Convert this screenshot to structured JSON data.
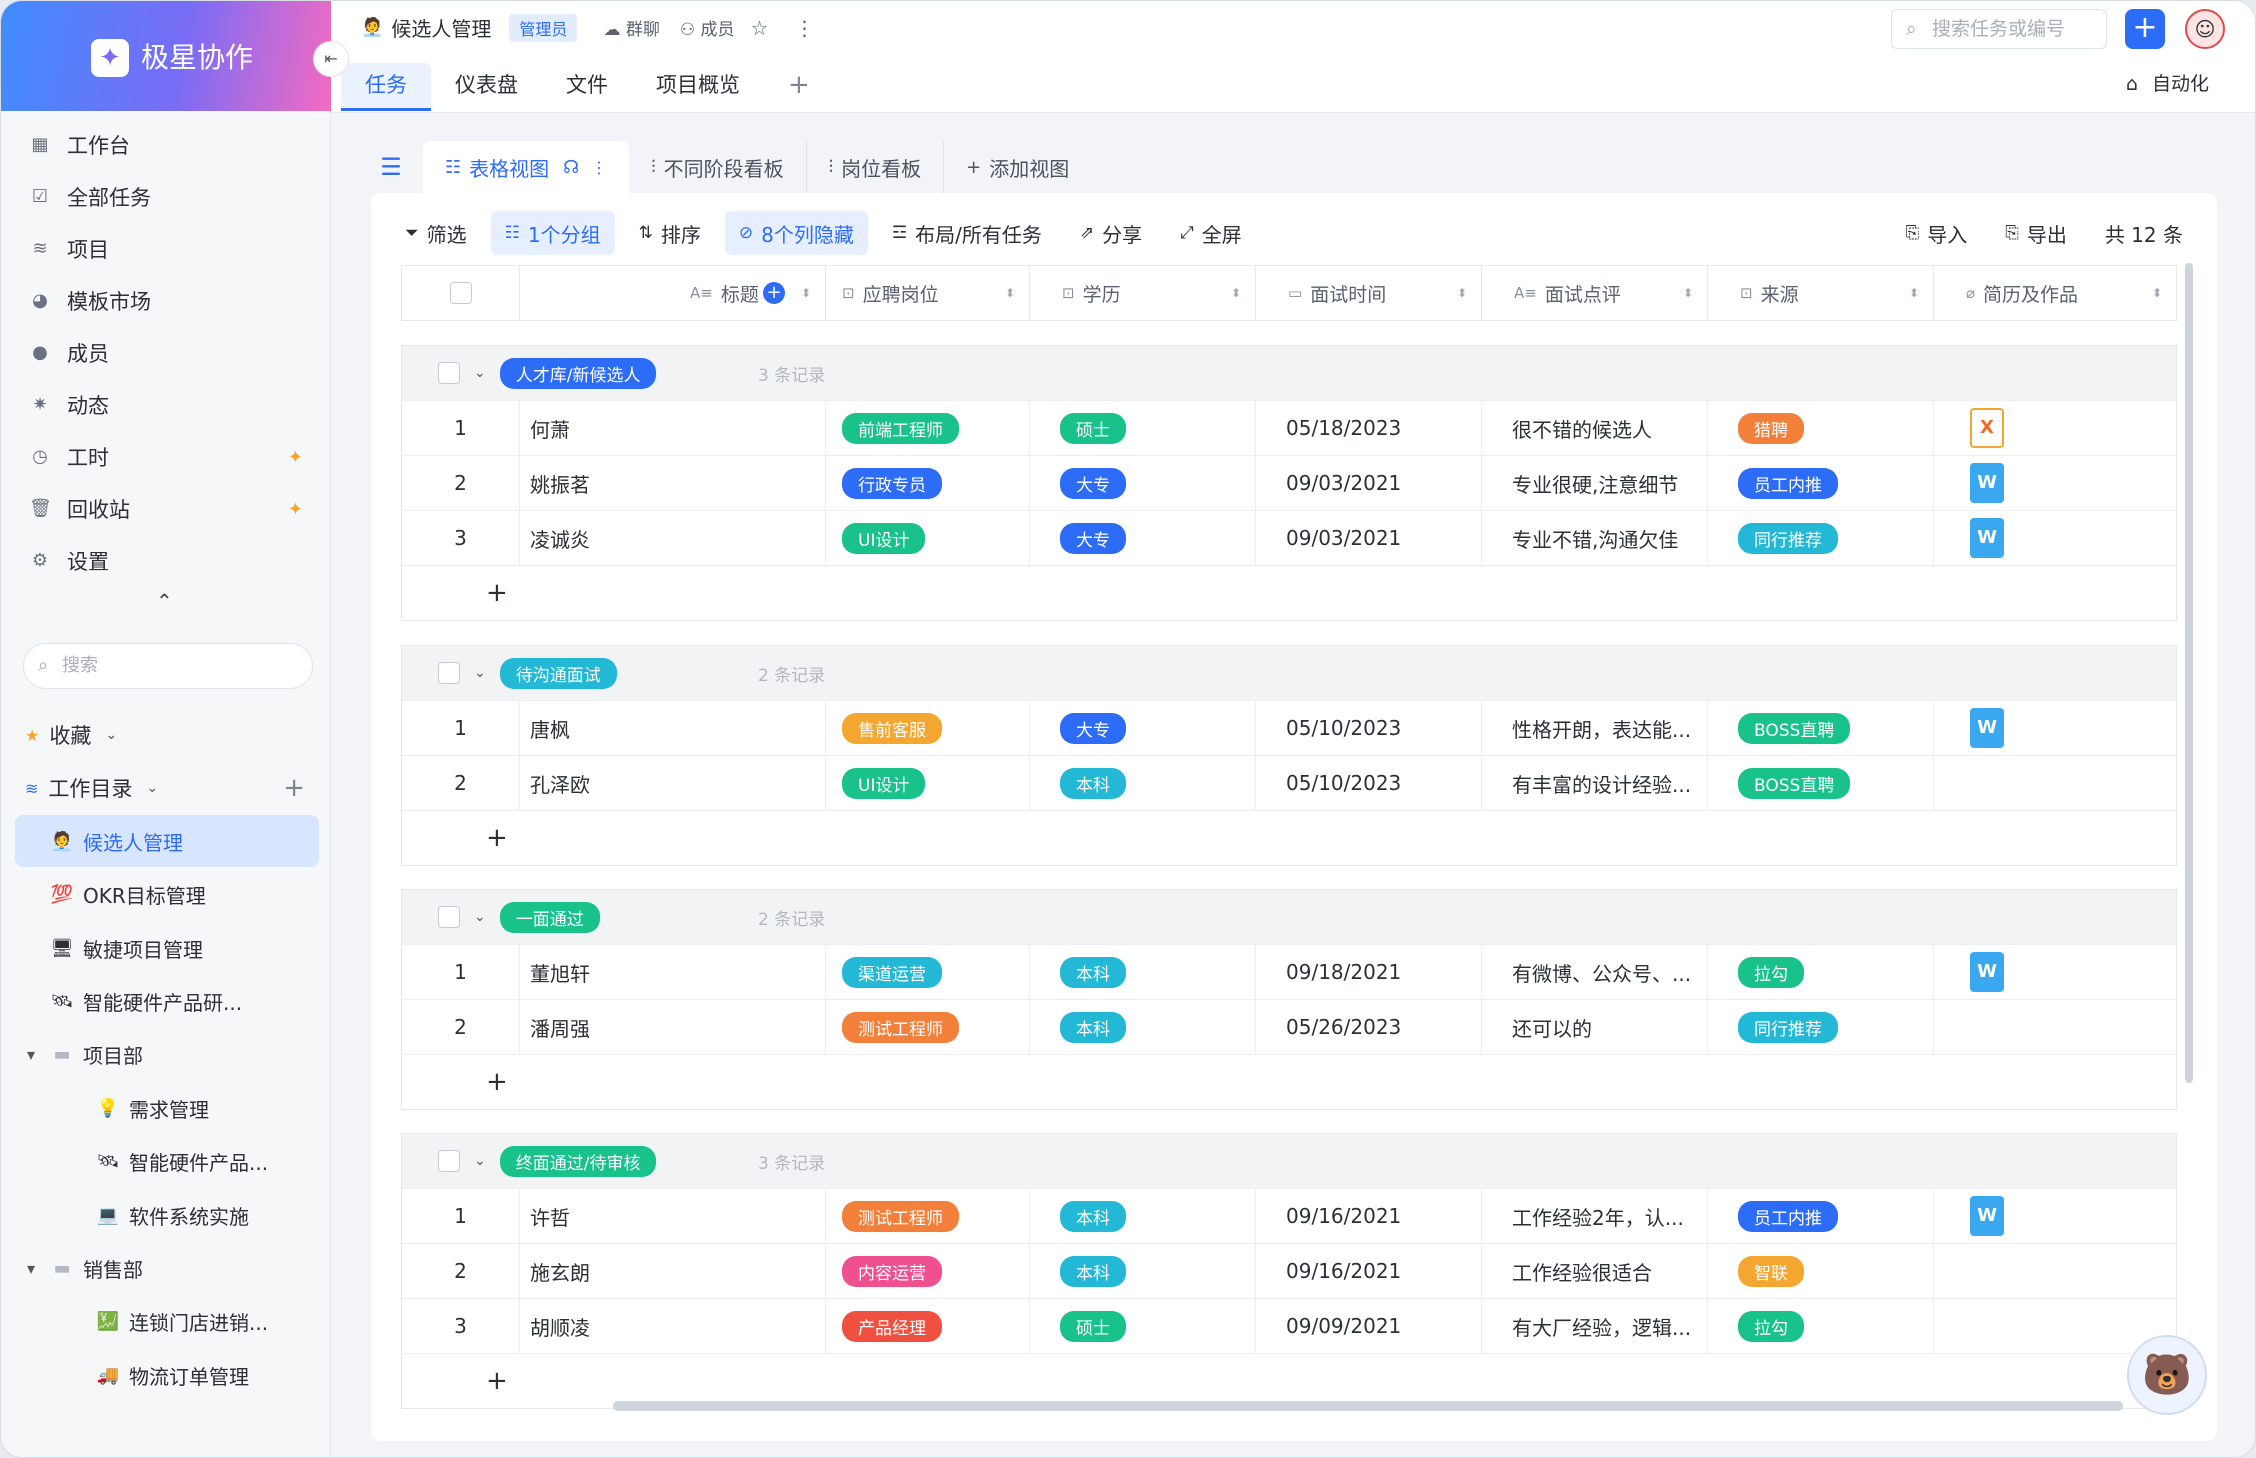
{
  "brand": {
    "logo": "✦",
    "name": "极星协作"
  },
  "sidebar": {
    "collapse_label": "⇤",
    "nav": [
      {
        "label": "工作台",
        "icon": "▦"
      },
      {
        "label": "全部任务",
        "icon": "☑"
      },
      {
        "label": "项目",
        "icon": "≋"
      },
      {
        "label": "模板市场",
        "icon": "◕"
      },
      {
        "label": "成员",
        "icon": "●"
      },
      {
        "label": "动态",
        "icon": "✷"
      },
      {
        "label": "工时",
        "icon": "◷",
        "star": "✦"
      },
      {
        "label": "回收站",
        "icon": "🗑",
        "star": "✦"
      },
      {
        "label": "设置",
        "icon": "⚙"
      }
    ],
    "search_placeholder": "搜索",
    "favorites_label": "收藏",
    "workdir_label": "工作目录",
    "tree": [
      {
        "label": "候选人管理",
        "emoji": "🧑‍💼"
      },
      {
        "label": "OKR目标管理",
        "emoji": "💯"
      },
      {
        "label": "敏捷项目管理",
        "emoji": "🖥"
      },
      {
        "label": "智能硬件产品研...",
        "emoji": "🛰"
      },
      {
        "label": "项目部",
        "emoji": "▬"
      },
      {
        "label": "需求管理",
        "emoji": "💡"
      },
      {
        "label": "智能硬件产品...",
        "emoji": "🛰"
      },
      {
        "label": "软件系统实施",
        "emoji": "💻"
      },
      {
        "label": "销售部",
        "emoji": "▬"
      },
      {
        "label": "连锁门店进销...",
        "emoji": "💹"
      },
      {
        "label": "物流订单管理",
        "emoji": "🚚"
      }
    ]
  },
  "header": {
    "project_emoji": "🧑‍💼",
    "project_title": "候选人管理",
    "role": "管理员",
    "group_chat": "群聊",
    "members": "成员",
    "search_placeholder": "搜索任务或编号",
    "add_label": "+",
    "tabs": [
      "任务",
      "仪表盘",
      "文件",
      "项目概览",
      "+"
    ],
    "automate": "自动化"
  },
  "views": {
    "tabs": [
      "表格视图",
      "不同阶段看板",
      "岗位看板",
      "添加视图"
    ]
  },
  "toolbar": {
    "filter": "筛选",
    "group": "1个分组",
    "sort": "排序",
    "hidden": "8个列隐藏",
    "layout": "布局/所有任务",
    "share": "分享",
    "fullscreen": "全屏",
    "import": "导入",
    "export": "导出",
    "total": "共 12 条"
  },
  "columns": [
    "标题",
    "应聘岗位",
    "学历",
    "面试时间",
    "面试点评",
    "来源",
    "简历及作品"
  ],
  "colors": {
    "accent": "#2d6cf6",
    "green": "#19c28a",
    "orange": "#f2803a",
    "blue": "#2d6cf6",
    "teal": "#22b8d6",
    "pink": "#f0508f",
    "red": "#f0503f",
    "gold": "#f4a630"
  },
  "groups": [
    {
      "name": "人才库/新候选人",
      "color": "#2d6cf6",
      "count": "3 条记录",
      "rows": [
        {
          "no": "1",
          "title": "何萧",
          "job": {
            "text": "前端工程师",
            "color": "#19c28a"
          },
          "edu": {
            "text": "硕士",
            "color": "#19c28a"
          },
          "time": "05/18/2023",
          "review": "很不错的候选人",
          "source": {
            "text": "猎聘",
            "color": "#f2803a"
          },
          "file": "X"
        },
        {
          "no": "2",
          "title": "姚振茗",
          "job": {
            "text": "行政专员",
            "color": "#2d6cf6"
          },
          "edu": {
            "text": "大专",
            "color": "#2d6cf6"
          },
          "time": "09/03/2021",
          "review": "专业很硬,注意细节",
          "source": {
            "text": "员工内推",
            "color": "#2d6cf6"
          },
          "file": "W"
        },
        {
          "no": "3",
          "title": "凌诚炎",
          "job": {
            "text": "UI设计",
            "color": "#19c28a"
          },
          "edu": {
            "text": "大专",
            "color": "#2d6cf6"
          },
          "time": "09/03/2021",
          "review": "专业不错,沟通欠佳",
          "source": {
            "text": "同行推荐",
            "color": "#22b8d6"
          },
          "file": "W"
        }
      ]
    },
    {
      "name": "待沟通面试",
      "color": "#22b8d6",
      "count": "2 条记录",
      "rows": [
        {
          "no": "1",
          "title": "唐枫",
          "job": {
            "text": "售前客服",
            "color": "#f4a630"
          },
          "edu": {
            "text": "大专",
            "color": "#2d6cf6"
          },
          "time": "05/10/2023",
          "review": "性格开朗，表达能...",
          "source": {
            "text": "BOSS直聘",
            "color": "#19c28a"
          },
          "file": "W"
        },
        {
          "no": "2",
          "title": "孔泽欧",
          "job": {
            "text": "UI设计",
            "color": "#19c28a"
          },
          "edu": {
            "text": "本科",
            "color": "#22b8d6"
          },
          "time": "05/10/2023",
          "review": "有丰富的设计经验...",
          "source": {
            "text": "BOSS直聘",
            "color": "#19c28a"
          },
          "file": ""
        }
      ]
    },
    {
      "name": "一面通过",
      "color": "#19c28a",
      "count": "2 条记录",
      "rows": [
        {
          "no": "1",
          "title": "董旭轩",
          "job": {
            "text": "渠道运营",
            "color": "#22b8d6"
          },
          "edu": {
            "text": "本科",
            "color": "#22b8d6"
          },
          "time": "09/18/2021",
          "review": "有微博、公众号、...",
          "source": {
            "text": "拉勾",
            "color": "#19c28a"
          },
          "file": "W"
        },
        {
          "no": "2",
          "title": "潘周强",
          "job": {
            "text": "测试工程师",
            "color": "#f2803a"
          },
          "edu": {
            "text": "本科",
            "color": "#22b8d6"
          },
          "time": "05/26/2023",
          "review": "还可以的",
          "source": {
            "text": "同行推荐",
            "color": "#22b8d6"
          },
          "file": ""
        }
      ]
    },
    {
      "name": "终面通过/待审核",
      "color": "#19c28a",
      "count": "3 条记录",
      "rows": [
        {
          "no": "1",
          "title": "许哲",
          "job": {
            "text": "测试工程师",
            "color": "#f2803a"
          },
          "edu": {
            "text": "本科",
            "color": "#22b8d6"
          },
          "time": "09/16/2021",
          "review": "工作经验2年，认...",
          "source": {
            "text": "员工内推",
            "color": "#2d6cf6"
          },
          "file": "W"
        },
        {
          "no": "2",
          "title": "施玄朗",
          "job": {
            "text": "内容运营",
            "color": "#f0508f"
          },
          "edu": {
            "text": "本科",
            "color": "#22b8d6"
          },
          "time": "09/16/2021",
          "review": "工作经验很适合",
          "source": {
            "text": "智联",
            "color": "#f4a630"
          },
          "file": ""
        },
        {
          "no": "3",
          "title": "胡顺凌",
          "job": {
            "text": "产品经理",
            "color": "#f0503f"
          },
          "edu": {
            "text": "硕士",
            "color": "#19c28a"
          },
          "time": "09/09/2021",
          "review": "有大厂经验，逻辑...",
          "source": {
            "text": "拉勾",
            "color": "#19c28a"
          },
          "file": ""
        }
      ]
    }
  ],
  "add_row_label": "+"
}
